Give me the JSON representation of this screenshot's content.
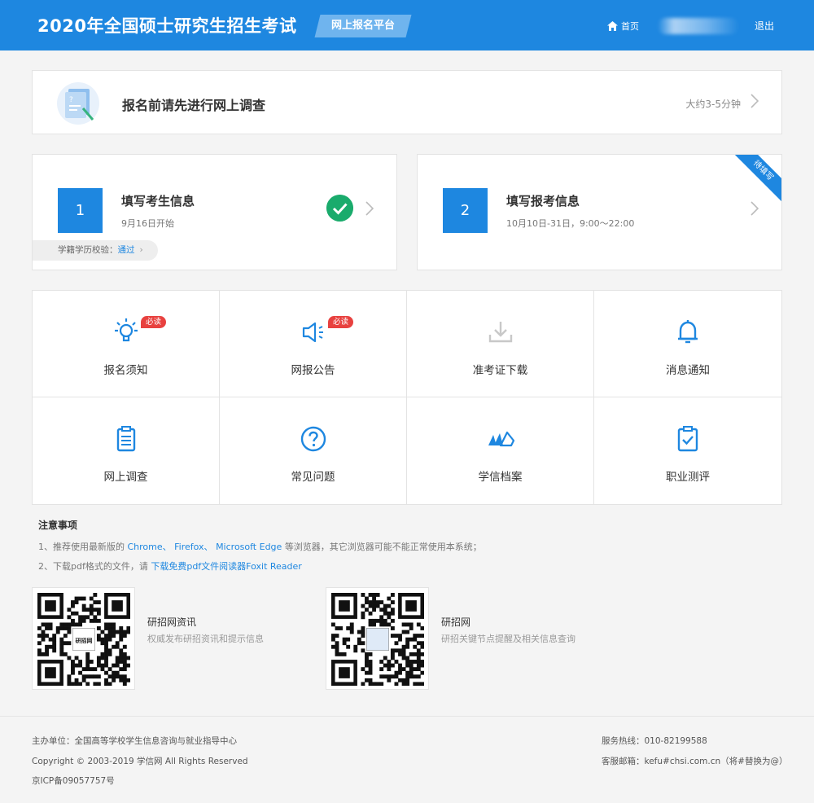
{
  "header": {
    "title": "2020年全国硕士研究生招生考试",
    "platform_tag": "网上报名平台",
    "home_label": "首页",
    "logout_label": "退出"
  },
  "survey": {
    "text": "报名前请先进行网上调查",
    "time": "大约3-5分钟"
  },
  "steps": [
    {
      "number": "1",
      "title": "填写考生信息",
      "subtitle": "9月16日开始",
      "verify_label": "学籍学历校验：",
      "verify_status": "通过",
      "completed": true
    },
    {
      "number": "2",
      "title": "填写报考信息",
      "subtitle": "10月10日-31日，9:00～22:00",
      "ribbon": "待填写",
      "completed": false
    }
  ],
  "grid": {
    "items": [
      {
        "label": "报名须知",
        "icon": "lightbulb-icon",
        "badge": "必读"
      },
      {
        "label": "网报公告",
        "icon": "megaphone-icon",
        "badge": "必读"
      },
      {
        "label": "准考证下载",
        "icon": "download-icon"
      },
      {
        "label": "消息通知",
        "icon": "bell-icon"
      },
      {
        "label": "网上调查",
        "icon": "clipboard-icon"
      },
      {
        "label": "常见问题",
        "icon": "question-icon"
      },
      {
        "label": "学信档案",
        "icon": "archive-icon"
      },
      {
        "label": "职业测评",
        "icon": "checklist-icon"
      }
    ]
  },
  "notes": {
    "title": "注意事项",
    "line1_prefix": "1、推荐使用最新版的",
    "chrome": "Chrome、",
    "firefox": "Firefox、",
    "edge": "Microsoft Edge",
    "line1_suffix": "等浏览器，其它浏览器可能不能正常使用本系统；",
    "line2_prefix": "2、下载pdf格式的文件，请",
    "line2_link": "下载免费pdf文件阅读器Foxit Reader"
  },
  "qr": [
    {
      "title": "研招网资讯",
      "desc": "权威发布研招资讯和提示信息",
      "center_text": "研招网"
    },
    {
      "title": "研招网",
      "desc": "研招关键节点提醒及相关信息查询"
    }
  ],
  "footer": {
    "host": "主办单位：全国高等学校学生信息咨询与就业指导中心",
    "copyright": "Copyright © 2003-2019 学信网 All Rights Reserved",
    "icp": "京ICP备09057757号",
    "hotline": "服务热线：010-82199588",
    "email": "客服邮箱：kefu#chsi.com.cn（将#替换为@）"
  },
  "colors": {
    "primary": "#1e87e0",
    "success": "#1aab6c",
    "badge": "#e8413f"
  }
}
